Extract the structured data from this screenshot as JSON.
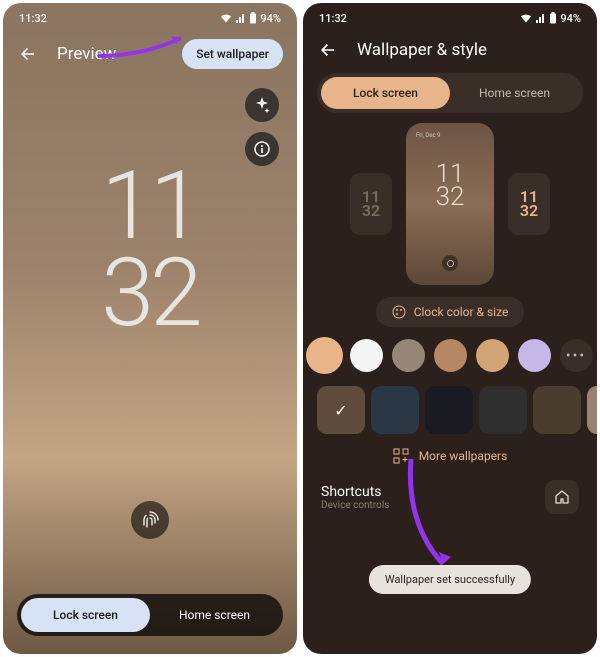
{
  "status": {
    "time": "11:32",
    "battery": "94%"
  },
  "left": {
    "title": "Preview",
    "set_wallpaper": "Set wallpaper",
    "clock_line1": "11",
    "clock_line2": "32",
    "tab_lock": "Lock screen",
    "tab_home": "Home screen"
  },
  "right": {
    "title": "Wallpaper & style",
    "tab_lock": "Lock screen",
    "tab_home": "Home screen",
    "mini_status": "Fri, Dec 9",
    "mini_clock1": "11",
    "mini_clock2": "32",
    "side_left": "11\n32",
    "side_right": "11\n32",
    "clock_color_size": "Clock color & size",
    "colors": [
      "#e8b48a",
      "#f5f5f5",
      "#968776",
      "#b58763",
      "#d4a574",
      "#c5b8e8"
    ],
    "more_dots": "•••",
    "thumbnails": [
      "#8a6d56",
      "#2a3845",
      "#1a1a22",
      "#2f2f2f",
      "#4a3d30",
      "#9a8270"
    ],
    "more_wallpapers": "More wallpapers",
    "shortcuts": "Shortcuts",
    "device_controls": "Device controls",
    "toast": "Wallpaper set successfully"
  }
}
